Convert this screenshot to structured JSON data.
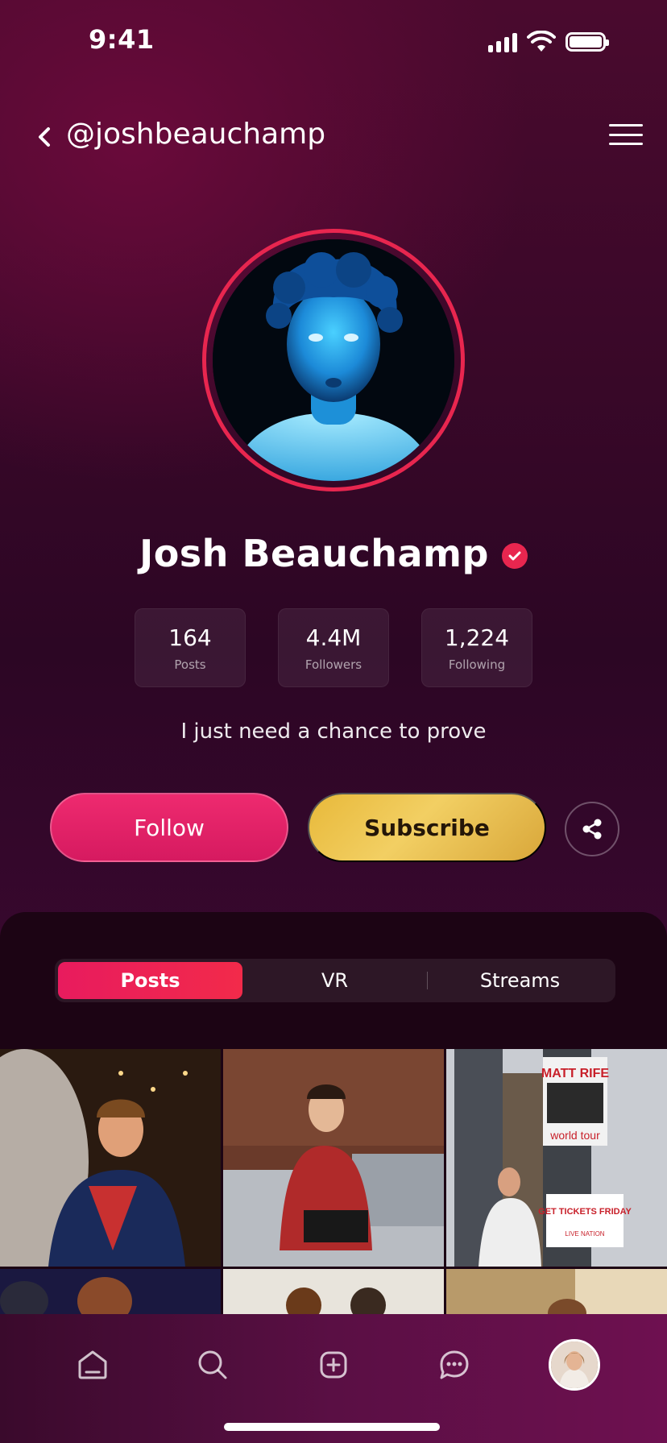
{
  "status_bar": {
    "time": "9:41"
  },
  "header": {
    "handle": "@joshbeauchamp"
  },
  "profile": {
    "name": "Josh Beauchamp",
    "verified": true,
    "bio": "I just need a chance to prove"
  },
  "stats": [
    {
      "value": "164",
      "label": "Posts"
    },
    {
      "value": "4.4M",
      "label": "Followers"
    },
    {
      "value": "1,224",
      "label": "Following"
    }
  ],
  "actions": {
    "follow_label": "Follow",
    "subscribe_label": "Subscribe"
  },
  "tabs": [
    {
      "label": "Posts",
      "active": true
    },
    {
      "label": "VR",
      "active": false
    },
    {
      "label": "Streams",
      "active": false
    }
  ],
  "grid_text": {
    "billboard_top": "MATT RIFE",
    "billboard_sub": "world tour",
    "billboard_cta": "GET TICKETS FRIDAY",
    "billboard_brand": "LIVE NATION"
  },
  "bottom_nav": [
    "home-icon",
    "search-icon",
    "create-icon",
    "chat-icon",
    "profile-avatar"
  ],
  "colors": {
    "accent": "#e8264f",
    "follow": "#e81b5e",
    "subscribe": "#eac04a",
    "panel": "#1c0414"
  }
}
